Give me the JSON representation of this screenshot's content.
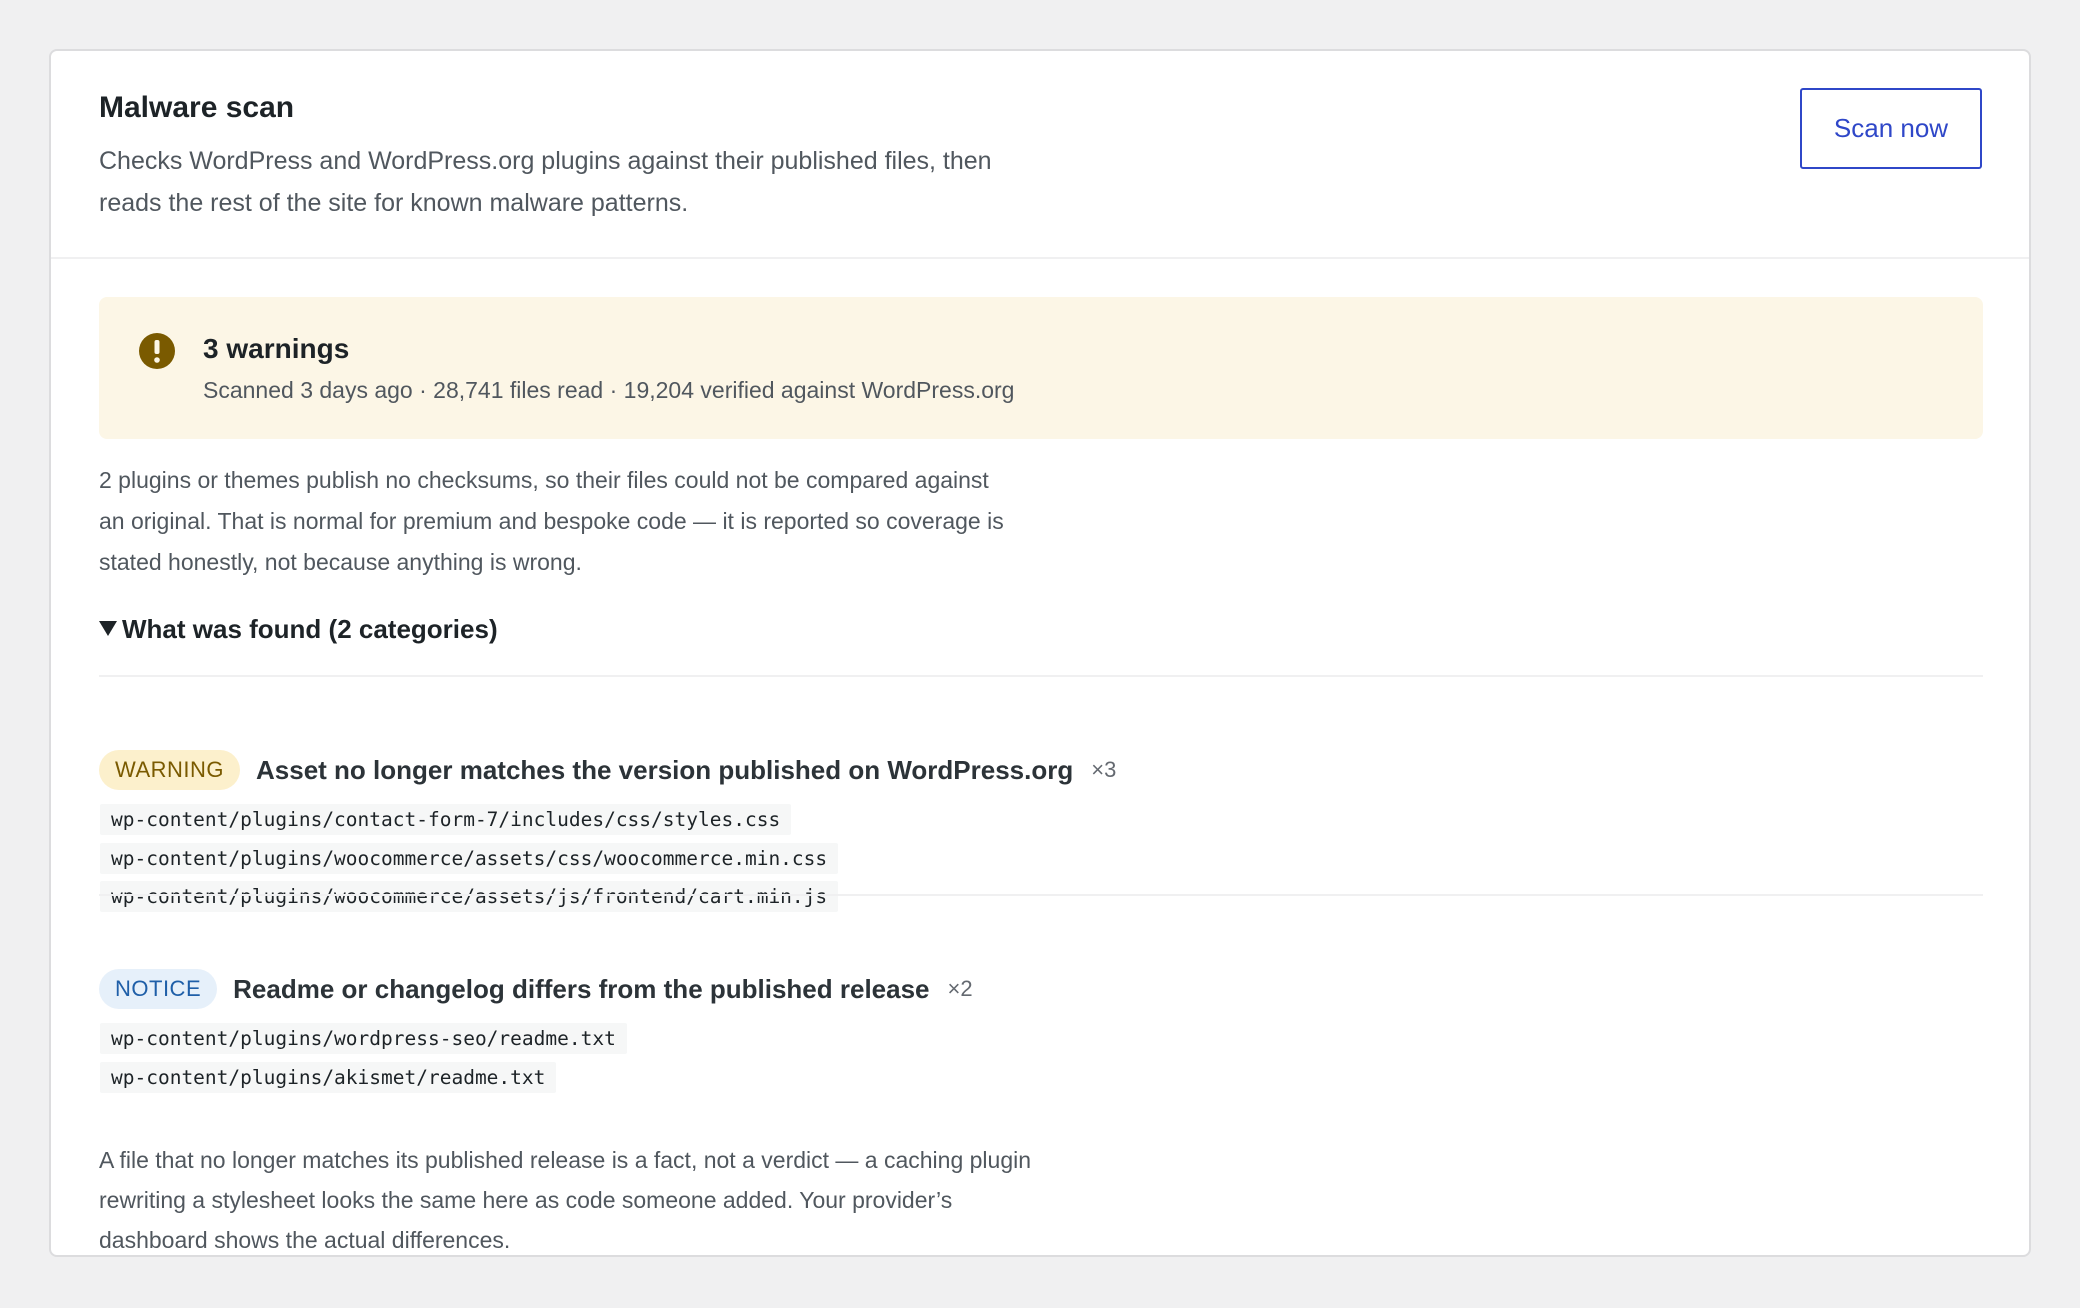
{
  "panel": {
    "title": "Malware scan",
    "description": "Checks WordPress and WordPress.org plugins against their published files, then reads the rest of the site for known malware patterns.",
    "scan_button_label": "Scan now"
  },
  "status": {
    "icon": "exclamation-circle-icon",
    "title": "3 warnings",
    "summary": "Scanned 3 days ago · 28,741 files read · 19,204 verified against WordPress.org",
    "color": "#7a5a00",
    "background": "#fcf6e6"
  },
  "coverage_note": "2 plugins or themes publish no checksums, so their files could not be compared against an original. That is normal for premium and bespoke code — it is reported so coverage is stated honestly, not because anything is wrong.",
  "findings": {
    "summary_label": "What was found (2 categories)",
    "expanded": true,
    "categories": [
      {
        "severity": "WARNING",
        "title": "Asset no longer matches the version published on WordPress.org",
        "count": "×3",
        "files": [
          "wp-content/plugins/contact-form-7/includes/css/styles.css",
          "wp-content/plugins/woocommerce/assets/css/woocommerce.min.css",
          "wp-content/plugins/woocommerce/assets/js/frontend/cart.min.js"
        ]
      },
      {
        "severity": "NOTICE",
        "title": "Readme or changelog differs from the published release",
        "count": "×2",
        "files": [
          "wp-content/plugins/wordpress-seo/readme.txt",
          "wp-content/plugins/akismet/readme.txt"
        ]
      }
    ]
  },
  "footer_note": "A file that no longer matches its published release is a fact, not a verdict — a caching plugin rewriting a stylesheet looks the same here as code someone added. Your provider’s dashboard shows the actual differences.",
  "colors": {
    "accent": "#2f47c8",
    "warning_badge_bg": "#fcf0cc",
    "warning_badge_text": "#7a5a00",
    "notice_badge_bg": "#e6f0fa",
    "notice_badge_text": "#1f5fa8"
  }
}
